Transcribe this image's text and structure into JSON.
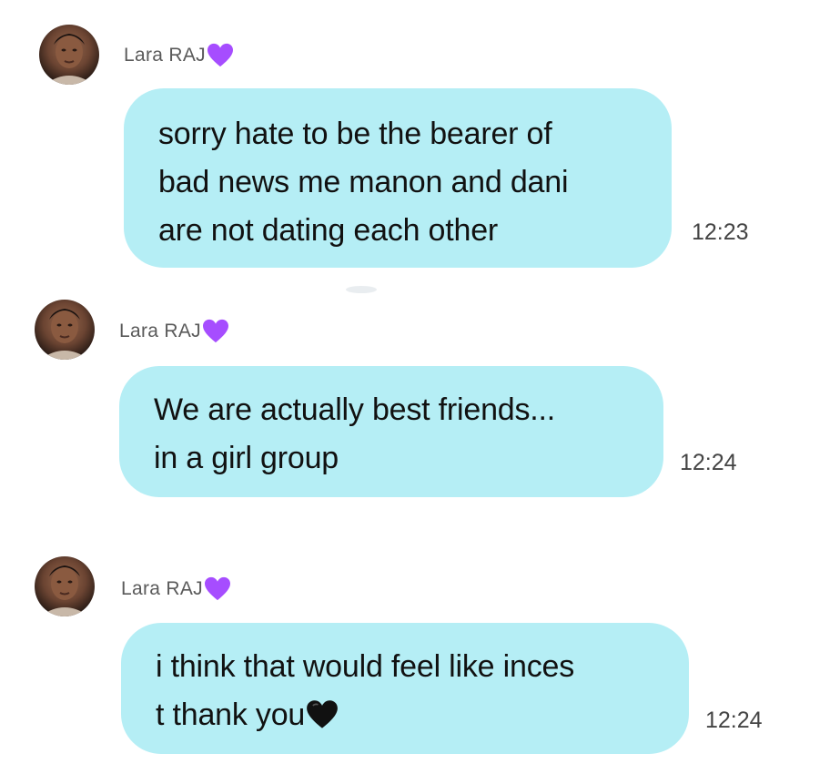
{
  "app": {
    "accent_bubble": "#b5eef5",
    "heart_purple": "#a64dff",
    "heart_black": "#111111"
  },
  "messages": [
    {
      "sender": "Lara RAJ",
      "sender_badge": "purple-heart-icon",
      "lines": [
        "sorry hate to be the bearer of",
        "bad news me manon and dani",
        "are not dating each other"
      ],
      "time": "12:23"
    },
    {
      "sender": "Lara RAJ",
      "sender_badge": "purple-heart-icon",
      "lines": [
        "We are actually best friends...",
        "in a girl group"
      ],
      "time": "12:24"
    },
    {
      "sender": "Lara RAJ",
      "sender_badge": "purple-heart-icon",
      "lines": [
        "i think that would feel like inces",
        "t thank you"
      ],
      "trailing_emoji": "black-heart-icon",
      "time": "12:24"
    }
  ]
}
